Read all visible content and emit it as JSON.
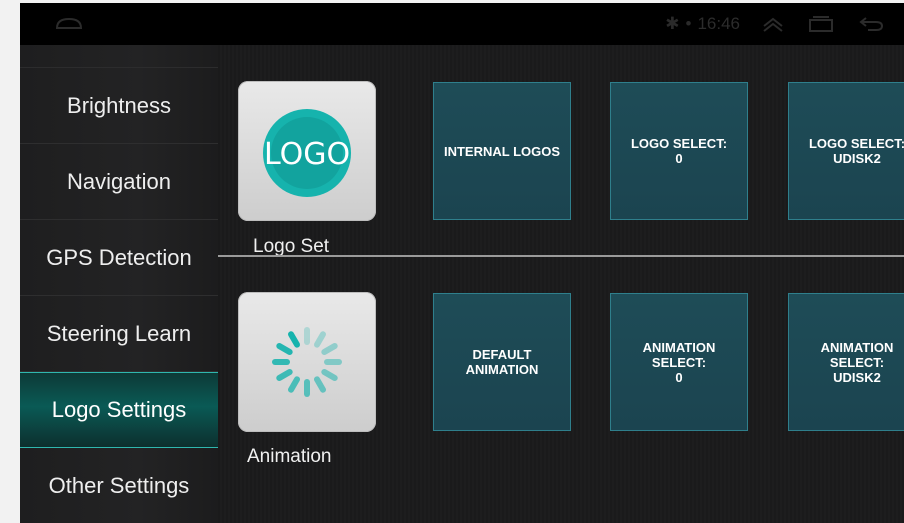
{
  "status_bar": {
    "bluetooth": "✱",
    "dot": "•",
    "time": "16:46"
  },
  "sidebar": {
    "items": [
      {
        "label": "Brightness"
      },
      {
        "label": "Navigation"
      },
      {
        "label": "GPS Detection"
      },
      {
        "label": "Steering Learn"
      },
      {
        "label": "Logo Settings",
        "active": true
      },
      {
        "label": "Other Settings"
      }
    ]
  },
  "logo_section": {
    "icon_text": "LOGO",
    "label": "Logo Set",
    "tiles": [
      {
        "title": "INTERNAL LOGOS",
        "value": ""
      },
      {
        "title": "LOGO SELECT:",
        "value": "0"
      },
      {
        "title": "LOGO SELECT:",
        "value": "UDISK2"
      }
    ]
  },
  "animation_section": {
    "label": "Animation",
    "tiles": [
      {
        "title": "DEFAULT ANIMATION",
        "value": ""
      },
      {
        "title": "ANIMATION SELECT:",
        "value": "0"
      },
      {
        "title": "ANIMATION SELECT:",
        "value": "UDISK2"
      }
    ]
  },
  "colors": {
    "accent": "#2fb7ae",
    "tile_bg": "#1e4c57",
    "logo_circle": "#16b3ad"
  }
}
